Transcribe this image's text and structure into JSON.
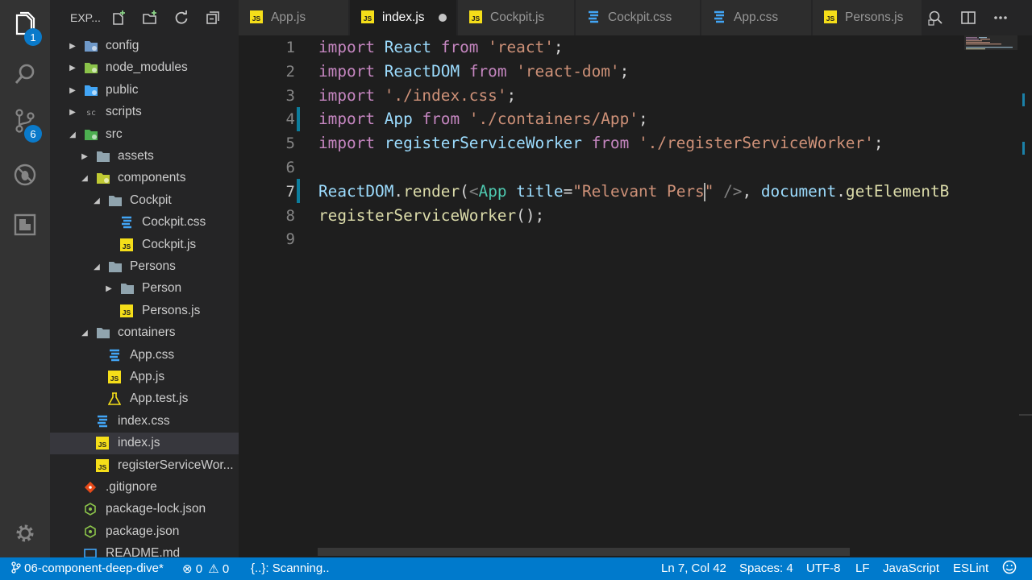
{
  "activity_bar": {
    "explorer_badge": "1",
    "scm_badge": "6"
  },
  "sidebar": {
    "title": "EXP...",
    "tree": [
      {
        "label": "config",
        "kind": "folder",
        "expanded": false,
        "icon": "config-folder-icon"
      },
      {
        "label": "node_modules",
        "kind": "folder",
        "expanded": false,
        "icon": "node-folder-icon"
      },
      {
        "label": "public",
        "kind": "folder",
        "expanded": false,
        "icon": "public-folder-icon"
      },
      {
        "label": "scripts",
        "kind": "folder",
        "expanded": false,
        "icon": "scripts-folder-icon"
      },
      {
        "label": "src",
        "kind": "folder",
        "expanded": true,
        "icon": "src-folder-icon"
      },
      {
        "label": "assets",
        "kind": "folder",
        "expanded": false,
        "icon": "folder-icon"
      },
      {
        "label": "components",
        "kind": "folder",
        "expanded": true,
        "icon": "components-folder-icon"
      },
      {
        "label": "Cockpit",
        "kind": "folder",
        "expanded": true,
        "icon": "folder-icon"
      },
      {
        "label": "Cockpit.css",
        "kind": "file",
        "icon": "css-file-icon"
      },
      {
        "label": "Cockpit.js",
        "kind": "file",
        "icon": "js-file-icon"
      },
      {
        "label": "Persons",
        "kind": "folder",
        "expanded": true,
        "icon": "folder-icon"
      },
      {
        "label": "Person",
        "kind": "folder",
        "expanded": false,
        "icon": "folder-icon"
      },
      {
        "label": "Persons.js",
        "kind": "file",
        "icon": "js-file-icon"
      },
      {
        "label": "containers",
        "kind": "folder",
        "expanded": true,
        "icon": "folder-icon"
      },
      {
        "label": "App.css",
        "kind": "file",
        "icon": "css-file-icon"
      },
      {
        "label": "App.js",
        "kind": "file",
        "icon": "js-file-icon"
      },
      {
        "label": "App.test.js",
        "kind": "file",
        "icon": "test-file-icon"
      },
      {
        "label": "index.css",
        "kind": "file",
        "icon": "css-file-icon"
      },
      {
        "label": "index.js",
        "kind": "file",
        "icon": "js-file-icon",
        "selected": true
      },
      {
        "label": "registerServiceWor...",
        "kind": "file",
        "icon": "js-file-icon"
      },
      {
        "label": ".gitignore",
        "kind": "file",
        "icon": "git-file-icon"
      },
      {
        "label": "package-lock.json",
        "kind": "file",
        "icon": "npm-file-icon"
      },
      {
        "label": "package.json",
        "kind": "file",
        "icon": "npm-file-icon"
      },
      {
        "label": "README.md",
        "kind": "file",
        "icon": "markdown-file-icon"
      }
    ]
  },
  "tabs": [
    {
      "label": "App.js",
      "icon": "js-file-icon"
    },
    {
      "label": "index.js",
      "icon": "js-file-icon",
      "active": true,
      "dirty": true
    },
    {
      "label": "Cockpit.js",
      "icon": "js-file-icon"
    },
    {
      "label": "Cockpit.css",
      "icon": "css-file-icon"
    },
    {
      "label": "App.css",
      "icon": "css-file-icon"
    },
    {
      "label": "Persons.js",
      "icon": "js-file-icon"
    }
  ],
  "editor": {
    "line_numbers": [
      "1",
      "2",
      "3",
      "4",
      "5",
      "6",
      "7",
      "8",
      "9"
    ],
    "lines": [
      [
        {
          "t": "import ",
          "c": "k"
        },
        {
          "t": "React ",
          "c": "v"
        },
        {
          "t": "from ",
          "c": "k"
        },
        {
          "t": "'react'",
          "c": "s"
        },
        {
          "t": ";",
          "c": "w"
        }
      ],
      [
        {
          "t": "import ",
          "c": "k"
        },
        {
          "t": "ReactDOM ",
          "c": "v"
        },
        {
          "t": "from ",
          "c": "k"
        },
        {
          "t": "'react-dom'",
          "c": "s"
        },
        {
          "t": ";",
          "c": "w"
        }
      ],
      [
        {
          "t": "import ",
          "c": "k"
        },
        {
          "t": "'./index.css'",
          "c": "s"
        },
        {
          "t": ";",
          "c": "w"
        }
      ],
      [
        {
          "t": "import ",
          "c": "k"
        },
        {
          "t": "App ",
          "c": "v"
        },
        {
          "t": "from ",
          "c": "k"
        },
        {
          "t": "'./containers/App'",
          "c": "s"
        },
        {
          "t": ";",
          "c": "w"
        }
      ],
      [
        {
          "t": "import ",
          "c": "k"
        },
        {
          "t": "registerServiceWorker ",
          "c": "v"
        },
        {
          "t": "from ",
          "c": "k"
        },
        {
          "t": "'./registerServiceWorker'",
          "c": "s"
        },
        {
          "t": ";",
          "c": "w"
        }
      ],
      [],
      [
        {
          "t": "ReactDOM",
          "c": "v"
        },
        {
          "t": ".",
          "c": "w"
        },
        {
          "t": "render",
          "c": "f"
        },
        {
          "t": "(",
          "c": "w"
        },
        {
          "t": "<",
          "c": "p"
        },
        {
          "t": "App ",
          "c": "t"
        },
        {
          "t": "title",
          "c": "v"
        },
        {
          "t": "=",
          "c": "w"
        },
        {
          "t": "\"Relevant Pers",
          "c": "s"
        },
        {
          "t": "|",
          "c": "cursor"
        },
        {
          "t": "\" ",
          "c": "s"
        },
        {
          "t": "/>",
          "c": "p"
        },
        {
          "t": ", ",
          "c": "w"
        },
        {
          "t": "document",
          "c": "v"
        },
        {
          "t": ".",
          "c": "w"
        },
        {
          "t": "getElementB",
          "c": "f"
        }
      ],
      [
        {
          "t": "registerServiceWorker",
          "c": "f"
        },
        {
          "t": "();",
          "c": "w"
        }
      ],
      []
    ]
  },
  "status_bar": {
    "branch": "06-component-deep-dive*",
    "errors": "0",
    "warnings": "0",
    "scanning": "{..}: Scanning..",
    "position": "Ln 7, Col 42",
    "spaces": "Spaces: 4",
    "encoding": "UTF-8",
    "eol": "LF",
    "language": "JavaScript",
    "linter": "ESLint"
  },
  "colors": {
    "status_bar": "#007acc",
    "activity_bar": "#333333",
    "sidebar": "#252526",
    "editor": "#1e1e1e",
    "badge": "#0a7aca"
  }
}
